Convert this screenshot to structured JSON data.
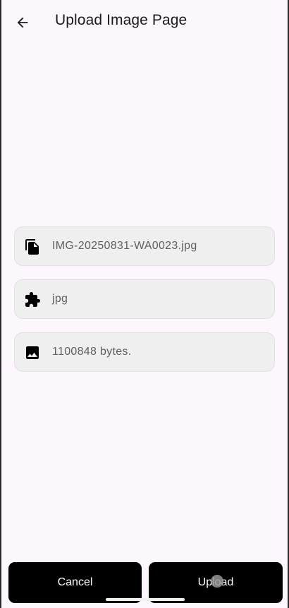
{
  "app_bar": {
    "title": "Upload Image Page",
    "back_icon": "arrow-left-icon"
  },
  "file_info": [
    {
      "icon": "file-copy-icon",
      "value": "IMG-20250831-WA0023.jpg"
    },
    {
      "icon": "extension-puzzle-icon",
      "value": "jpg"
    },
    {
      "icon": "image-icon",
      "value": "1100848 bytes."
    }
  ],
  "actions": {
    "cancel_label": "Cancel",
    "upload_label": "Upload"
  },
  "colors": {
    "background": "#fcf7fc",
    "card": "#efefef",
    "button": "#000000",
    "button_text": "#ffffff"
  }
}
